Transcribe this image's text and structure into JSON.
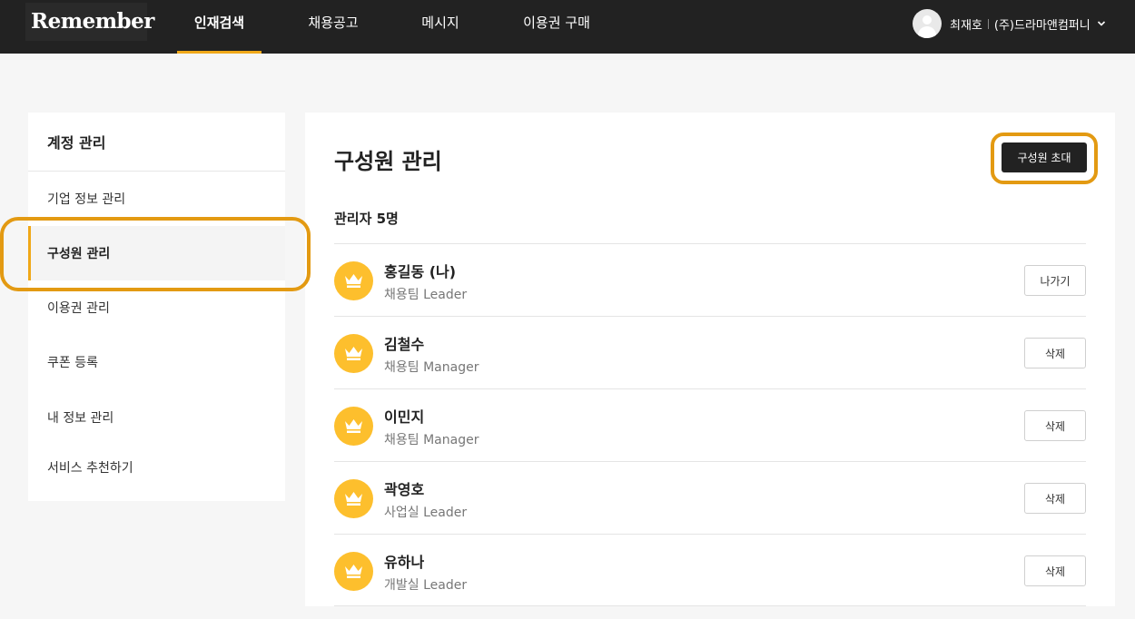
{
  "header": {
    "logo": "Remember",
    "nav": [
      {
        "label": "인재검색",
        "active": true
      },
      {
        "label": "채용공고",
        "active": false
      },
      {
        "label": "메시지",
        "active": false
      },
      {
        "label": "이용권 구매",
        "active": false
      }
    ],
    "user_name": "최재호",
    "company": "(주)드라마앤컴퍼니",
    "accent_color": "#f0a818"
  },
  "sidebar": {
    "title": "계정 관리",
    "items": [
      {
        "label": "기업 정보 관리",
        "active": false
      },
      {
        "label": "구성원 관리",
        "active": true
      },
      {
        "label": "이용권 관리",
        "active": false
      },
      {
        "label": "쿠폰 등록",
        "active": false
      },
      {
        "label": "내 정보 관리",
        "active": false
      },
      {
        "label": "서비스 추천하기",
        "active": false
      }
    ]
  },
  "main": {
    "title": "구성원 관리",
    "invite_label": "구성원 초대",
    "section_label": "관리자 5명",
    "members": [
      {
        "name": "홍길동 (나)",
        "role": "채용팀 Leader",
        "action": "나가기",
        "icon": "crown-icon"
      },
      {
        "name": "김철수",
        "role": "채용팀 Manager",
        "action": "삭제",
        "icon": "crown-icon"
      },
      {
        "name": "이민지",
        "role": "채용팀 Manager",
        "action": "삭제",
        "icon": "crown-icon"
      },
      {
        "name": "곽영호",
        "role": "사업실 Leader",
        "action": "삭제",
        "icon": "crown-icon"
      },
      {
        "name": "유하나",
        "role": "개발실 Leader",
        "action": "삭제",
        "icon": "crown-icon"
      }
    ]
  },
  "colors": {
    "topbar": "#222222",
    "badge": "#fdbf2d",
    "highlight": "#e39a12"
  }
}
